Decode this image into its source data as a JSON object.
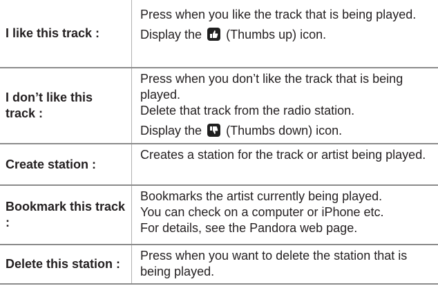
{
  "rows": [
    {
      "term": "I like this track :",
      "desc": [
        "Press when you like the track that is being played."
      ],
      "icon_line": {
        "before": "Display the",
        "after": "(Thumbs up) icon.",
        "icon": "thumbs-up-icon"
      }
    },
    {
      "term": "I don’t like this track :",
      "desc": [
        "Press when you don’t like the track that is being played.",
        "Delete that track from the radio station."
      ],
      "icon_line": {
        "before": "Display the",
        "after": "(Thumbs down) icon.",
        "icon": "thumbs-down-icon"
      }
    },
    {
      "term": "Create station :",
      "desc": [
        "Creates a station for the track or artist being played."
      ]
    },
    {
      "term": "Bookmark this track :",
      "desc": [
        "Bookmarks the artist currently being played.",
        "You can check on a computer or iPhone etc.",
        "For details, see the Pandora web page."
      ]
    },
    {
      "term": "Delete this station :",
      "desc": [
        "Press when you want to delete the station that is being played."
      ]
    }
  ]
}
